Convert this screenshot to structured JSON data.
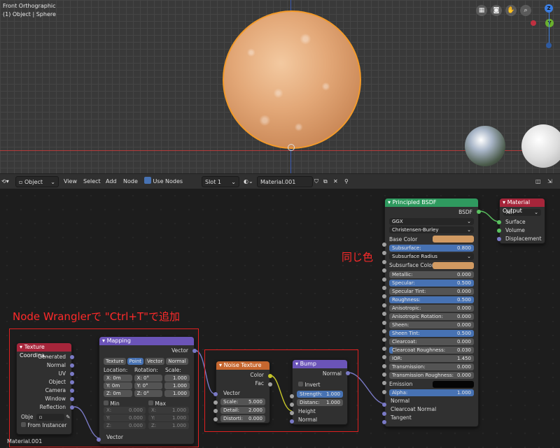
{
  "viewport": {
    "view_name": "Front Orthographic",
    "object_info": "(1) Object | Sphere",
    "gizmo": {
      "z": "Z",
      "y": "Y"
    }
  },
  "header": {
    "editor_icon": "node-editor-icon",
    "mode": "Object",
    "menu_view": "View",
    "menu_select": "Select",
    "menu_add": "Add",
    "menu_node": "Node",
    "use_nodes_label": "Use Nodes",
    "slot": "Slot 1",
    "material": "Material.001"
  },
  "annotations": {
    "same_color": "同じ色",
    "node_wrangler": "Node Wranglerで \"Ctrl+T\"で追加"
  },
  "material_label": "Material.001",
  "nodes": {
    "texcoord": {
      "title": "Texture Coordina...",
      "outputs": [
        "Generated",
        "Normal",
        "UV",
        "Object",
        "Camera",
        "Window",
        "Reflection"
      ],
      "object_label": "Obje",
      "from_instancer": "From Instancer"
    },
    "mapping": {
      "title": "Mapping",
      "output": "Vector",
      "tabs": [
        "Texture",
        "Point",
        "Vector",
        "Normal"
      ],
      "col_location": "Location:",
      "col_rotation": "Rotation:",
      "col_scale": "Scale:",
      "loc": [
        "X: 0m",
        "Y: 0m",
        "Z: 0m"
      ],
      "rot": [
        "X:  0°",
        "Y:  0°",
        "Z:  0°"
      ],
      "scale": [
        "1.000",
        "1.000",
        "1.000"
      ],
      "min_label": "Min",
      "max_label": "Max",
      "min": [
        [
          "X:",
          "0.000"
        ],
        [
          "Y:",
          "0.000"
        ],
        [
          "Z:",
          "0.000"
        ]
      ],
      "max": [
        [
          "X:",
          "1.000"
        ],
        [
          "Y:",
          "1.000"
        ],
        [
          "Z:",
          "1.000"
        ]
      ],
      "input": "Vector"
    },
    "noise": {
      "title": "Noise Texture",
      "out_color": "Color",
      "out_fac": "Fac",
      "in_vector": "Vector",
      "scale_label": "Scale:",
      "scale_val": "5.000",
      "detail_label": "Detail:",
      "detail_val": "2.000",
      "distortion_label": "Distorti:",
      "distortion_val": "0.000"
    },
    "bump": {
      "title": "Bump",
      "out_normal": "Normal",
      "invert": "Invert",
      "strength_label": "Strength:",
      "strength_val": "1.000",
      "distance_label": "Distanc:",
      "distance_val": "1.000",
      "in_height": "Height",
      "in_normal": "Normal"
    },
    "bsdf": {
      "title": "Principled BSDF",
      "output": "BSDF",
      "distribution": "GGX",
      "subsurface_method": "Christensen-Burley",
      "base_color": "Base Color",
      "subsurface_label": "Subsurface:",
      "subsurface_val": "0.800",
      "subsurface_radius": "Subsurface Radius",
      "subsurface_color": "Subsurface Color",
      "params": [
        [
          "Metallic:",
          "0.000"
        ],
        [
          "Specular:",
          "0.500"
        ],
        [
          "Specular Tint:",
          "0.000"
        ],
        [
          "Roughness:",
          "0.500"
        ],
        [
          "Anisotropic:",
          "0.000"
        ],
        [
          "Anisotropic Rotation:",
          "0.000"
        ],
        [
          "Sheen:",
          "0.000"
        ],
        [
          "Sheen Tint:",
          "0.500"
        ],
        [
          "Clearcoat:",
          "0.000"
        ],
        [
          "Clearcoat Roughness:",
          "0.030"
        ],
        [
          "IOR:",
          "1.450"
        ],
        [
          "Transmission:",
          "0.000"
        ],
        [
          "Transmission Roughness:",
          "0.000"
        ]
      ],
      "emission": "Emission",
      "alpha_label": "Alpha:",
      "alpha_val": "1.000",
      "normal": "Normal",
      "clearcoat_normal": "Clearcoat Normal",
      "tangent": "Tangent"
    },
    "output": {
      "title": "Material Output",
      "target": "All",
      "surface": "Surface",
      "volume": "Volume",
      "displacement": "Displacement"
    }
  },
  "colors": {
    "base_color": "#d19a62",
    "accent": "#4772b3",
    "annotation": "#ff2a2a"
  }
}
